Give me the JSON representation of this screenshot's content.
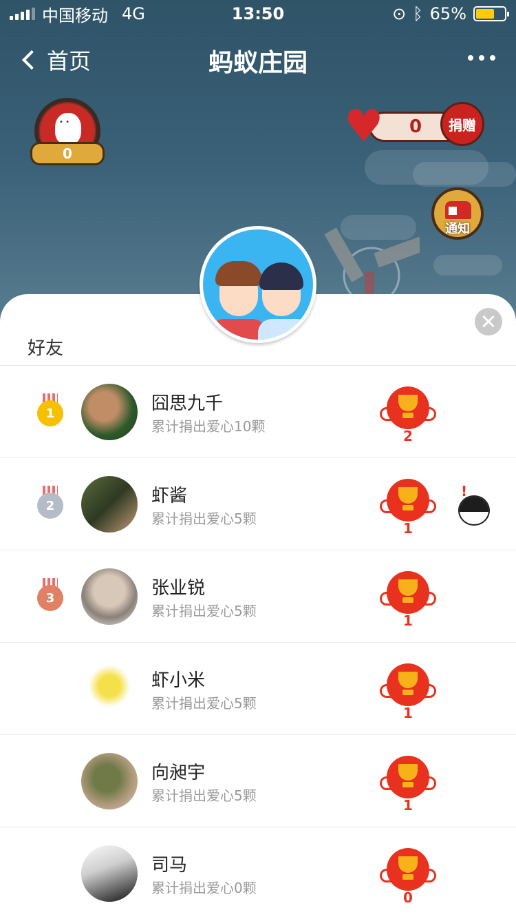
{
  "status_bar": {
    "carrier": "中国移动",
    "network": "4G",
    "time": "13:50",
    "battery": "65%",
    "battery_level": 0.65,
    "battery_color": "#ffcc00"
  },
  "nav": {
    "back_label": "首页",
    "title": "蚂蚁庄园"
  },
  "farm": {
    "medal_count": "0",
    "donate_count": "0",
    "donate_button": "捐赠",
    "notice_label": "通知"
  },
  "sheet": {
    "title": "好友"
  },
  "friends": [
    {
      "rank": "1",
      "name": "囧思九千",
      "desc": "累计捐出爱心10颗",
      "trophies": "2",
      "avatar": "photo",
      "has_bird": false
    },
    {
      "rank": "2",
      "name": "虾酱",
      "desc": "累计捐出爱心5颗",
      "trophies": "1",
      "avatar": "photo",
      "has_bird": true
    },
    {
      "rank": "3",
      "name": "张业锐",
      "desc": "累计捐出爱心5颗",
      "trophies": "1",
      "avatar": "photo",
      "has_bird": false
    },
    {
      "rank": "",
      "name": "虾小米",
      "desc": "累计捐出爱心5颗",
      "trophies": "1",
      "avatar": "cartoon",
      "has_bird": false
    },
    {
      "rank": "",
      "name": "向昶宇",
      "desc": "累计捐出爱心5颗",
      "trophies": "1",
      "avatar": "photo",
      "has_bird": false
    },
    {
      "rank": "",
      "name": "司马",
      "desc": "累计捐出爱心0颗",
      "trophies": "0",
      "avatar": "photo",
      "has_bird": false
    }
  ],
  "colors": {
    "medal_gold": "#f6c000",
    "medal_silver": "#b5bcc7",
    "medal_bronze": "#e08064",
    "trophy_red": "#e8321f"
  }
}
